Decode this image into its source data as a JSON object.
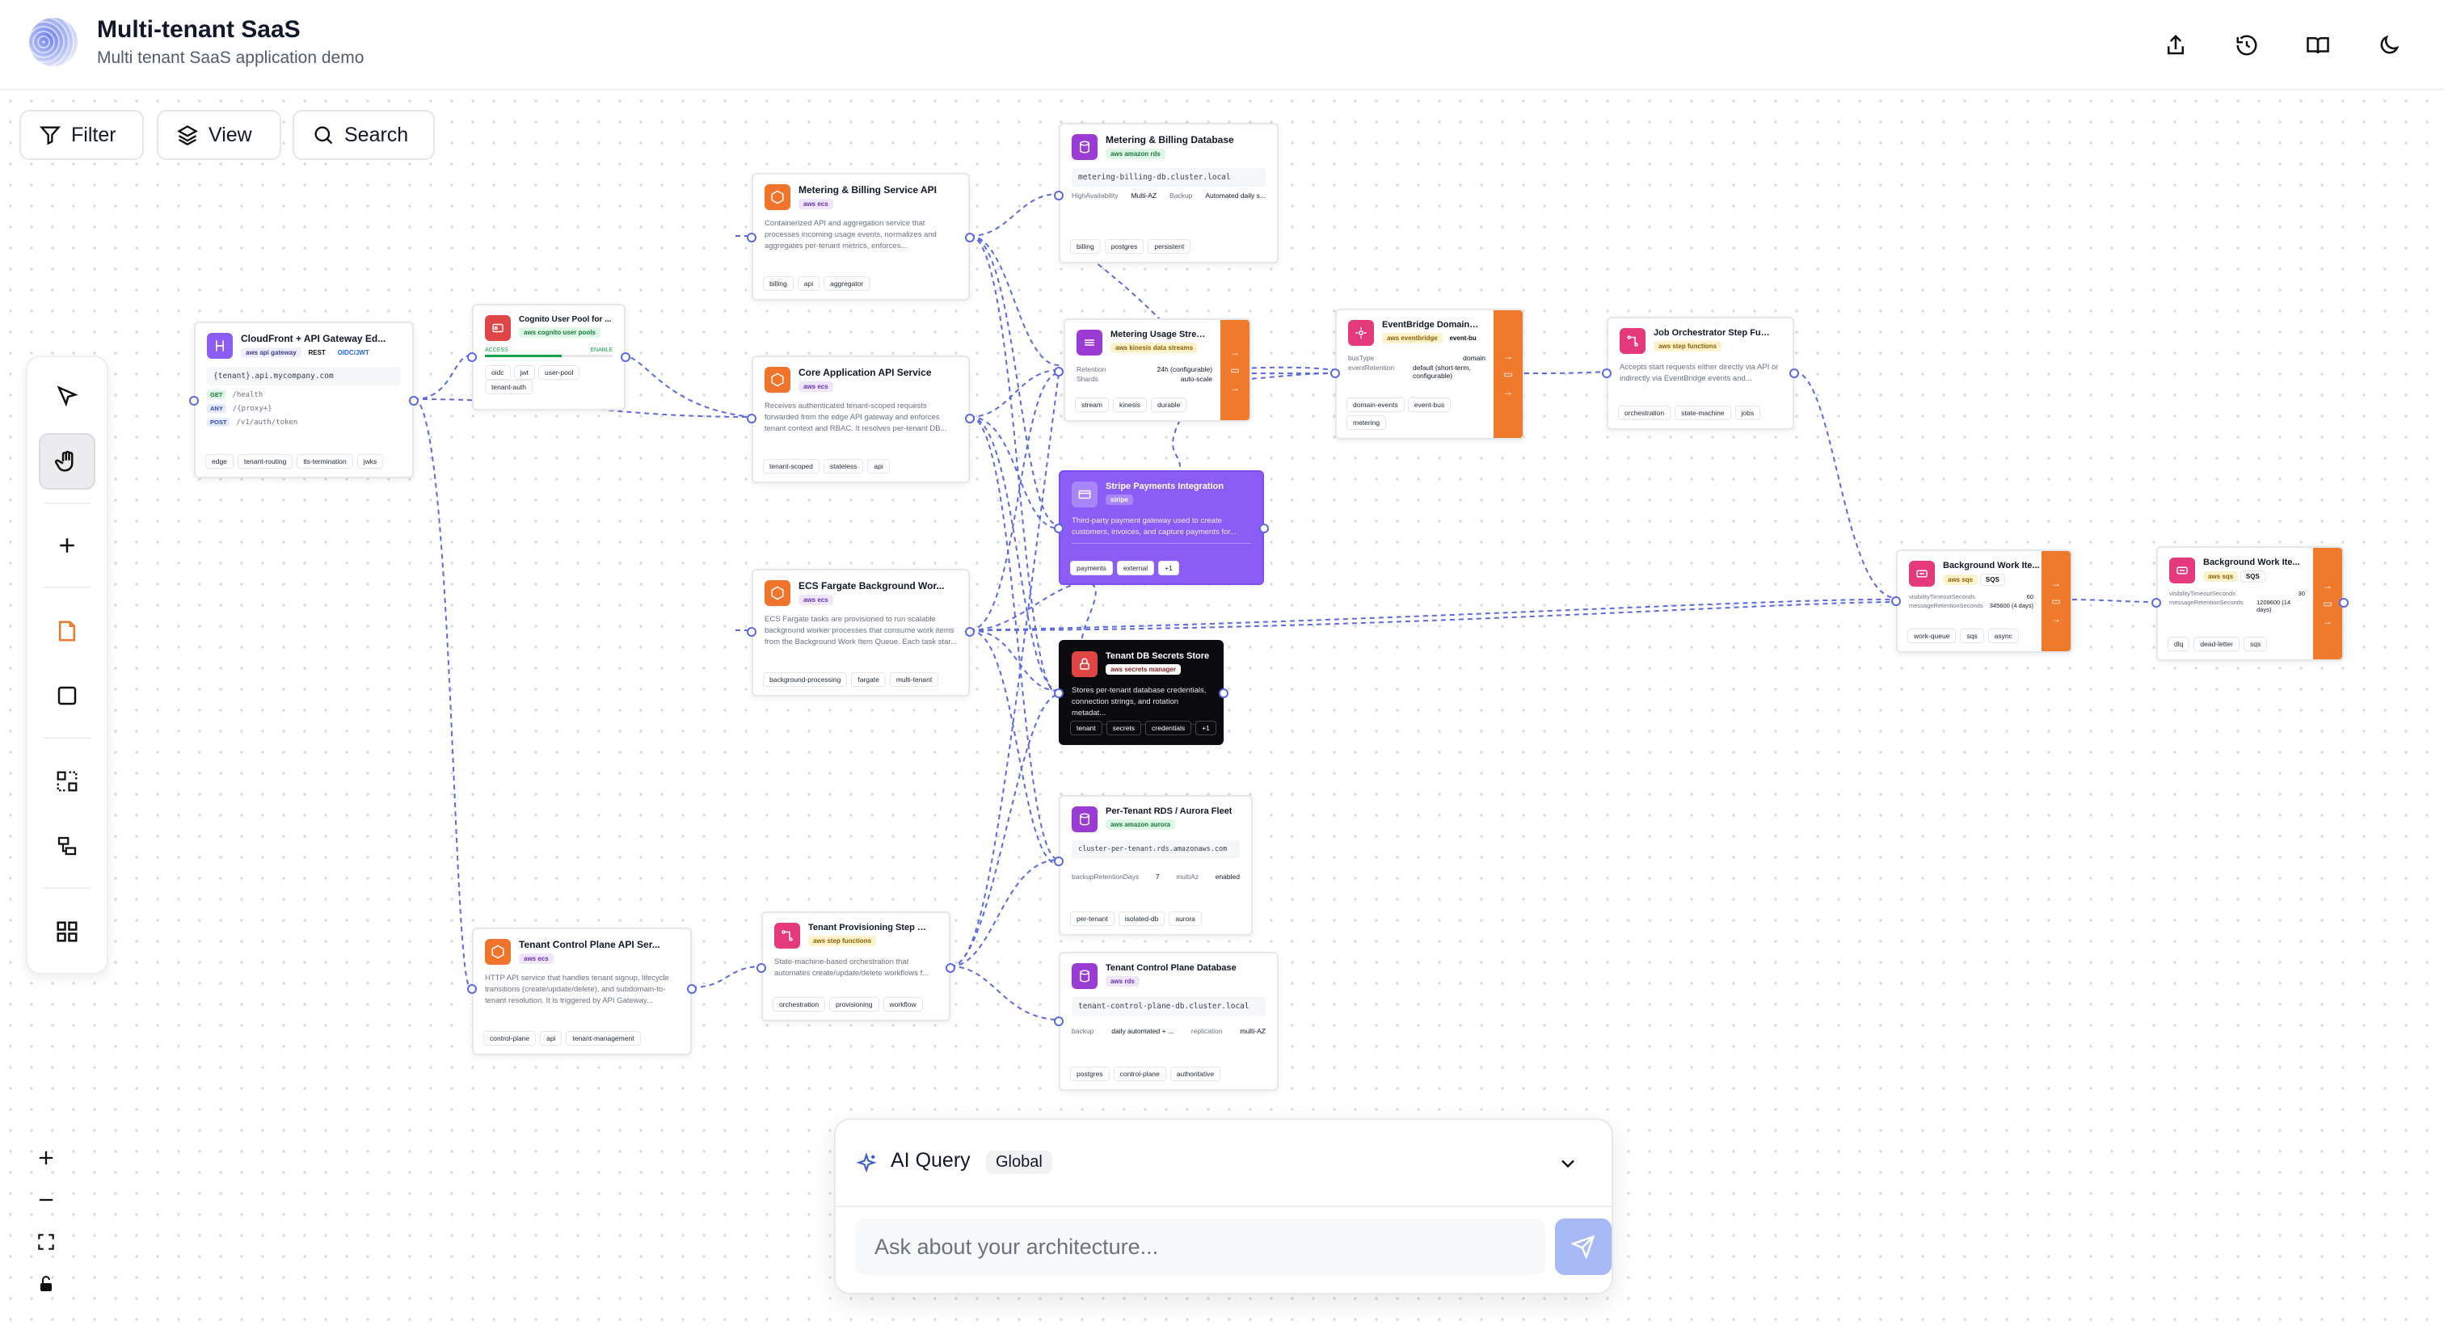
{
  "app": {
    "title": "Multi-tenant SaaS",
    "subtitle": "Multi tenant SaaS application demo"
  },
  "header_actions": [
    "share-icon",
    "history-icon",
    "book-icon",
    "moon-icon"
  ],
  "toolbar": {
    "filter_label": "Filter",
    "view_label": "View",
    "search_label": "Search"
  },
  "tools": [
    "pointer-icon",
    "hand-icon",
    "plus-icon",
    "note-icon",
    "rectangle-icon",
    "group-icon",
    "layout-icon",
    "grid-icon"
  ],
  "zoom": [
    "zoom-in-icon",
    "zoom-out-icon",
    "fit-view-icon",
    "lock-icon"
  ],
  "ai_query": {
    "title": "AI Query",
    "scope": "Global",
    "placeholder": "Ask about your architecture..."
  },
  "colors": {
    "edge": "#5b6ae0",
    "queue": "#f07a2c",
    "stripe": "#8b5cf6",
    "secrets": "#0b0b0f",
    "send": "#a8baf5"
  },
  "nodes": {
    "cloudfront": {
      "title": "CloudFront + API Gateway Ed...",
      "badges": [
        "aws api gateway",
        "REST",
        "OIDC/JWT"
      ],
      "url": "{tenant}.api.mycompany.com",
      "routes": [
        {
          "method": "GET",
          "path": "/health"
        },
        {
          "method": "ANY",
          "path": "/{proxy+}"
        },
        {
          "method": "POST",
          "path": "/v1/auth/token"
        }
      ],
      "tags": [
        "edge",
        "tenant-routing",
        "tls-termination",
        "jwks"
      ]
    },
    "cognito": {
      "title": "Cognito User Pool for ...",
      "badge": "aws cognito user pools",
      "status_left": "ACCESS",
      "status_right": "ENABLE",
      "tags": [
        "oidc",
        "jwt",
        "user-pool",
        "tenant-auth"
      ]
    },
    "metering_api": {
      "title": "Metering & Billing Service API",
      "badge": "aws ecs",
      "desc": "Containerized API and aggregation service that processes incoming usage events, normalizes and aggregates per-tenant metrics, enforces...",
      "tags": [
        "billing",
        "api",
        "aggregator"
      ]
    },
    "core_api": {
      "title": "Core Application API Service",
      "badge": "aws ecs",
      "desc": "Receives authenticated tenant-scoped requests forwarded from the edge API gateway and enforces tenant context and RBAC. It resolves per-tenant DB...",
      "tags": [
        "tenant-scoped",
        "stateless",
        "api"
      ]
    },
    "fargate": {
      "title": "ECS Fargate Background Wor...",
      "badge": "aws ecs",
      "desc": "ECS Fargate tasks are provisioned to run scalable background worker processes that consume work items from the Background Work Item Queue. Each task star...",
      "tags": [
        "background-processing",
        "fargate",
        "multi-tenant"
      ]
    },
    "control_api": {
      "title": "Tenant Control Plane API Ser...",
      "badge": "aws ecs",
      "desc": "HTTP API service that handles tenant signup, lifecycle transitions (create/update/delete), and subdomain-to-tenant resolution. It is triggered by API Gateway...",
      "tags": [
        "control-plane",
        "api",
        "tenant-management"
      ]
    },
    "provisioning": {
      "title": "Tenant Provisioning Step Fun...",
      "badge": "aws step functions",
      "desc": "State-machine-based orchestration that automates create/update/delete workflows f...",
      "tags": [
        "orchestration",
        "provisioning",
        "workflow"
      ]
    },
    "metering_db": {
      "title": "Metering & Billing Database",
      "badge": "aws amazon rds",
      "endpoint": "metering-billing-db.cluster.local",
      "kv": [
        {
          "k": "HighAvailability",
          "v": "Multi-AZ"
        },
        {
          "k": "Backup",
          "v": "Automated daily s..."
        }
      ],
      "tags": [
        "billing",
        "postgres",
        "persistent"
      ]
    },
    "usage_stream": {
      "title": "Metering Usage Stream",
      "badge": "aws kinesis data streams",
      "kv": [
        {
          "k": "Retention",
          "v": "24h (configurable)"
        },
        {
          "k": "Shards",
          "v": "auto-scale"
        }
      ],
      "tags": [
        "stream",
        "kinesis",
        "durable"
      ]
    },
    "eventbridge": {
      "title": "EventBridge Domain ...",
      "badge": "aws eventbridge",
      "badge2": "event-bu",
      "kv": [
        {
          "k": "busType",
          "v": "domain"
        },
        {
          "k": "eventRetention",
          "v": "default (short-term, configurable)"
        }
      ],
      "tags": [
        "domain-events",
        "event-bus",
        "metering"
      ]
    },
    "job_orch": {
      "title": "Job Orchestrator Step Functi...",
      "badge": "aws step functions",
      "desc": "Accepts start requests either directly via API or indirectly via EventBridge events and...",
      "tags": [
        "orchestration",
        "state-machine",
        "jobs"
      ]
    },
    "stripe": {
      "title": "Stripe Payments Integration",
      "badge": "stripe",
      "desc": "Third-party payment gateway used to create customers, invoices, and capture payments for...",
      "tags": [
        "payments",
        "external",
        "+1"
      ]
    },
    "secrets": {
      "title": "Tenant DB Secrets Store",
      "badge": "aws secrets manager",
      "desc": "Stores per-tenant database credentials, connection strings, and rotation metadat...",
      "tags": [
        "tenant",
        "secrets",
        "credentials",
        "+1"
      ]
    },
    "rds_fleet": {
      "title": "Per-Tenant RDS / Aurora Fleet",
      "badge": "aws amazon aurora",
      "endpoint": "cluster-per-tenant.rds.amazonaws.com",
      "kv": [
        {
          "k": "backupRetentionDays",
          "v": "7"
        },
        {
          "k": "multiAz",
          "v": "enabled"
        }
      ],
      "tags": [
        "per-tenant",
        "isolated-db",
        "aurora"
      ]
    },
    "control_db": {
      "title": "Tenant Control Plane Database",
      "badge": "aws rds",
      "endpoint": "tenant-control-plane-db.cluster.local",
      "kv": [
        {
          "k": "backup",
          "v": "daily automated + ..."
        },
        {
          "k": "replication",
          "v": "multi-AZ"
        }
      ],
      "tags": [
        "postgres",
        "control-plane",
        "authoritative"
      ]
    },
    "work_queue": {
      "title": "Background Work Ite...",
      "badge": "aws sqs",
      "badge2": "SQS",
      "kv": [
        {
          "k": "visibilityTimeoutSeconds",
          "v": "60"
        },
        {
          "k": "messageRetentionSeconds",
          "v": "345600 (4 days)"
        }
      ],
      "tags": [
        "work-queue",
        "sqs",
        "async"
      ]
    },
    "dlq": {
      "title": "Background Work Ite...",
      "badge": "aws sqs",
      "badge2": "SQS",
      "kv": [
        {
          "k": "visibilityTimeoutSeconds",
          "v": "30"
        },
        {
          "k": "messageRetentionSeconds",
          "v": "1209600 (14 days)"
        }
      ],
      "tags": [
        "dlq",
        "dead-letter",
        "sqs"
      ]
    }
  }
}
